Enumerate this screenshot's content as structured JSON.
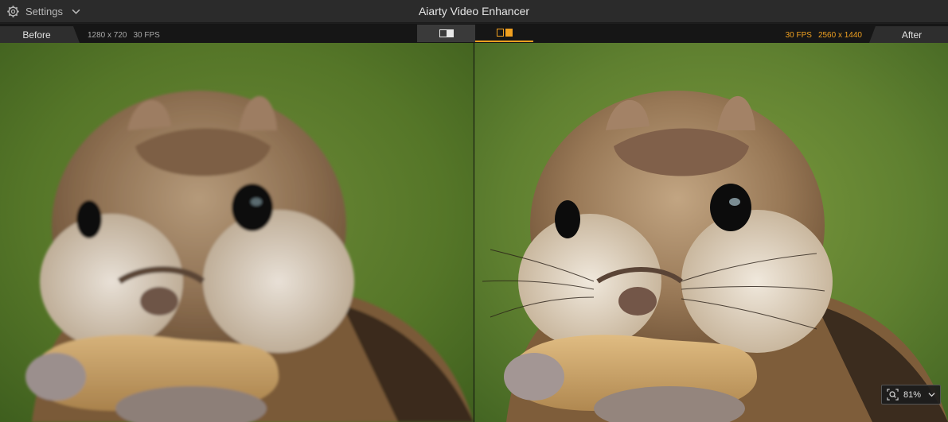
{
  "window": {
    "title": "Aiarty Video Enhancer"
  },
  "settings": {
    "label": "Settings",
    "icon": "gear-icon"
  },
  "compare": {
    "before_label": "Before",
    "after_label": "After",
    "source": {
      "resolution": "1280 x 720",
      "fps": "30 FPS"
    },
    "output": {
      "fps": "30 FPS",
      "resolution": "2560 x 1440"
    },
    "modes": [
      {
        "name": "split-view",
        "active": false
      },
      {
        "name": "side-by-side",
        "active": true
      }
    ],
    "accent": "#f0a020"
  },
  "zoom": {
    "value": "81%",
    "icon": "zoom-icon"
  }
}
